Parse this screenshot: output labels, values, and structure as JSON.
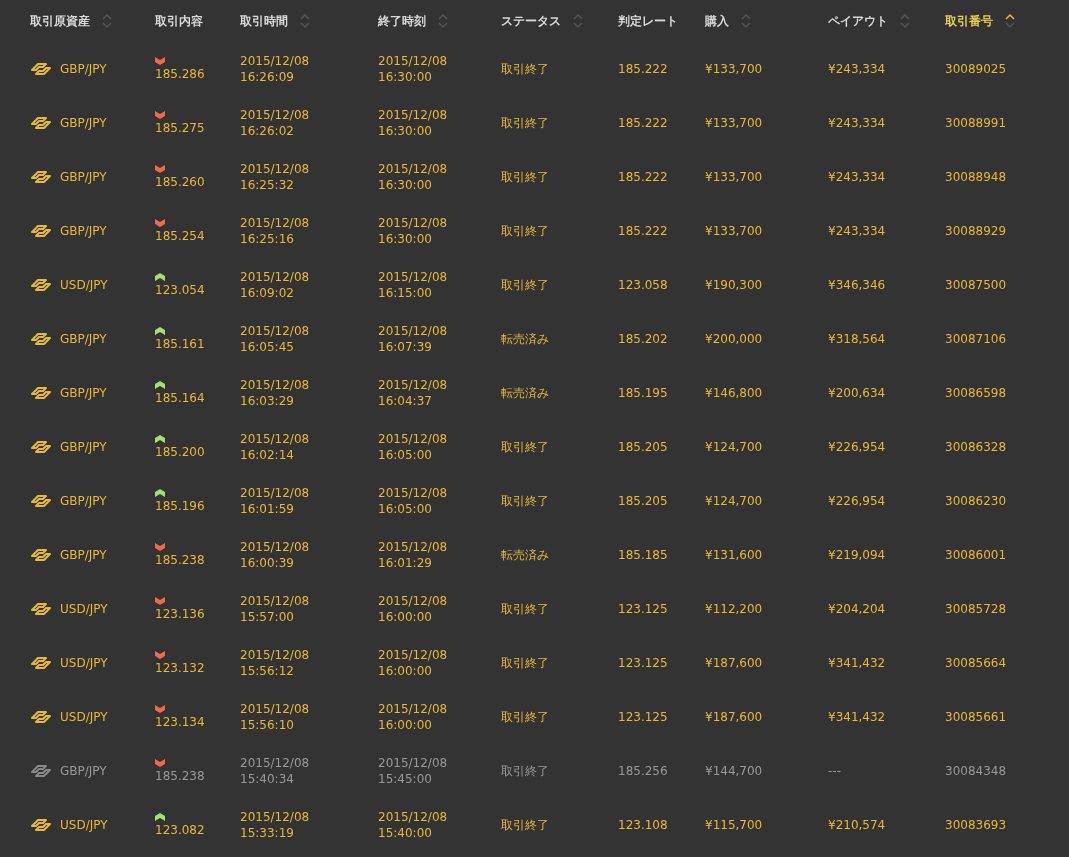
{
  "table": {
    "columns": [
      {
        "label": "取引原資産",
        "sortable": true,
        "sorted": false
      },
      {
        "label": "取引内容",
        "sortable": false,
        "sorted": false
      },
      {
        "label": "取引時間",
        "sortable": true,
        "sorted": false
      },
      {
        "label": "終了時刻",
        "sortable": true,
        "sorted": false
      },
      {
        "label": "ステータス",
        "sortable": true,
        "sorted": false
      },
      {
        "label": "判定レート",
        "sortable": false,
        "sorted": false
      },
      {
        "label": "購入",
        "sortable": true,
        "sorted": false
      },
      {
        "label": "ペイアウト",
        "sortable": true,
        "sorted": false
      },
      {
        "label": "取引番号",
        "sortable": true,
        "sorted": true
      }
    ],
    "rows": [
      {
        "asset": "GBP/JPY",
        "kind": "down",
        "rate": "185.286",
        "start_date": "2015/12/08",
        "start_time": "16:26:09",
        "end_date": "2015/12/08",
        "end_time": "16:30:00",
        "status": "取引終了",
        "judge_rate": "185.222",
        "purchase": "¥133,700",
        "payout": "¥243,334",
        "trade_no": "30089025",
        "dimmed": false
      },
      {
        "asset": "GBP/JPY",
        "kind": "down",
        "rate": "185.275",
        "start_date": "2015/12/08",
        "start_time": "16:26:02",
        "end_date": "2015/12/08",
        "end_time": "16:30:00",
        "status": "取引終了",
        "judge_rate": "185.222",
        "purchase": "¥133,700",
        "payout": "¥243,334",
        "trade_no": "30088991",
        "dimmed": false
      },
      {
        "asset": "GBP/JPY",
        "kind": "down",
        "rate": "185.260",
        "start_date": "2015/12/08",
        "start_time": "16:25:32",
        "end_date": "2015/12/08",
        "end_time": "16:30:00",
        "status": "取引終了",
        "judge_rate": "185.222",
        "purchase": "¥133,700",
        "payout": "¥243,334",
        "trade_no": "30088948",
        "dimmed": false
      },
      {
        "asset": "GBP/JPY",
        "kind": "down",
        "rate": "185.254",
        "start_date": "2015/12/08",
        "start_time": "16:25:16",
        "end_date": "2015/12/08",
        "end_time": "16:30:00",
        "status": "取引終了",
        "judge_rate": "185.222",
        "purchase": "¥133,700",
        "payout": "¥243,334",
        "trade_no": "30088929",
        "dimmed": false
      },
      {
        "asset": "USD/JPY",
        "kind": "up",
        "rate": "123.054",
        "start_date": "2015/12/08",
        "start_time": "16:09:02",
        "end_date": "2015/12/08",
        "end_time": "16:15:00",
        "status": "取引終了",
        "judge_rate": "123.058",
        "purchase": "¥190,300",
        "payout": "¥346,346",
        "trade_no": "30087500",
        "dimmed": false
      },
      {
        "asset": "GBP/JPY",
        "kind": "up",
        "rate": "185.161",
        "start_date": "2015/12/08",
        "start_time": "16:05:45",
        "end_date": "2015/12/08",
        "end_time": "16:07:39",
        "status": "転売済み",
        "judge_rate": "185.202",
        "purchase": "¥200,000",
        "payout": "¥318,564",
        "trade_no": "30087106",
        "dimmed": false
      },
      {
        "asset": "GBP/JPY",
        "kind": "up",
        "rate": "185.164",
        "start_date": "2015/12/08",
        "start_time": "16:03:29",
        "end_date": "2015/12/08",
        "end_time": "16:04:37",
        "status": "転売済み",
        "judge_rate": "185.195",
        "purchase": "¥146,800",
        "payout": "¥200,634",
        "trade_no": "30086598",
        "dimmed": false
      },
      {
        "asset": "GBP/JPY",
        "kind": "up",
        "rate": "185.200",
        "start_date": "2015/12/08",
        "start_time": "16:02:14",
        "end_date": "2015/12/08",
        "end_time": "16:05:00",
        "status": "取引終了",
        "judge_rate": "185.205",
        "purchase": "¥124,700",
        "payout": "¥226,954",
        "trade_no": "30086328",
        "dimmed": false
      },
      {
        "asset": "GBP/JPY",
        "kind": "up",
        "rate": "185.196",
        "start_date": "2015/12/08",
        "start_time": "16:01:59",
        "end_date": "2015/12/08",
        "end_time": "16:05:00",
        "status": "取引終了",
        "judge_rate": "185.205",
        "purchase": "¥124,700",
        "payout": "¥226,954",
        "trade_no": "30086230",
        "dimmed": false
      },
      {
        "asset": "GBP/JPY",
        "kind": "down",
        "rate": "185.238",
        "start_date": "2015/12/08",
        "start_time": "16:00:39",
        "end_date": "2015/12/08",
        "end_time": "16:01:29",
        "status": "転売済み",
        "judge_rate": "185.185",
        "purchase": "¥131,600",
        "payout": "¥219,094",
        "trade_no": "30086001",
        "dimmed": false
      },
      {
        "asset": "USD/JPY",
        "kind": "down",
        "rate": "123.136",
        "start_date": "2015/12/08",
        "start_time": "15:57:00",
        "end_date": "2015/12/08",
        "end_time": "16:00:00",
        "status": "取引終了",
        "judge_rate": "123.125",
        "purchase": "¥112,200",
        "payout": "¥204,204",
        "trade_no": "30085728",
        "dimmed": false
      },
      {
        "asset": "USD/JPY",
        "kind": "down",
        "rate": "123.132",
        "start_date": "2015/12/08",
        "start_time": "15:56:12",
        "end_date": "2015/12/08",
        "end_time": "16:00:00",
        "status": "取引終了",
        "judge_rate": "123.125",
        "purchase": "¥187,600",
        "payout": "¥341,432",
        "trade_no": "30085664",
        "dimmed": false
      },
      {
        "asset": "USD/JPY",
        "kind": "down",
        "rate": "123.134",
        "start_date": "2015/12/08",
        "start_time": "15:56:10",
        "end_date": "2015/12/08",
        "end_time": "16:00:00",
        "status": "取引終了",
        "judge_rate": "123.125",
        "purchase": "¥187,600",
        "payout": "¥341,432",
        "trade_no": "30085661",
        "dimmed": false
      },
      {
        "asset": "GBP/JPY",
        "kind": "down",
        "rate": "185.238",
        "start_date": "2015/12/08",
        "start_time": "15:40:34",
        "end_date": "2015/12/08",
        "end_time": "15:45:00",
        "status": "取引終了",
        "judge_rate": "185.256",
        "purchase": "¥144,700",
        "payout": "---",
        "trade_no": "30084348",
        "dimmed": true
      },
      {
        "asset": "USD/JPY",
        "kind": "up",
        "rate": "123.082",
        "start_date": "2015/12/08",
        "start_time": "15:33:19",
        "end_date": "2015/12/08",
        "end_time": "15:40:00",
        "status": "取引終了",
        "judge_rate": "123.108",
        "purchase": "¥115,700",
        "payout": "¥210,574",
        "trade_no": "30083693",
        "dimmed": false
      }
    ]
  }
}
